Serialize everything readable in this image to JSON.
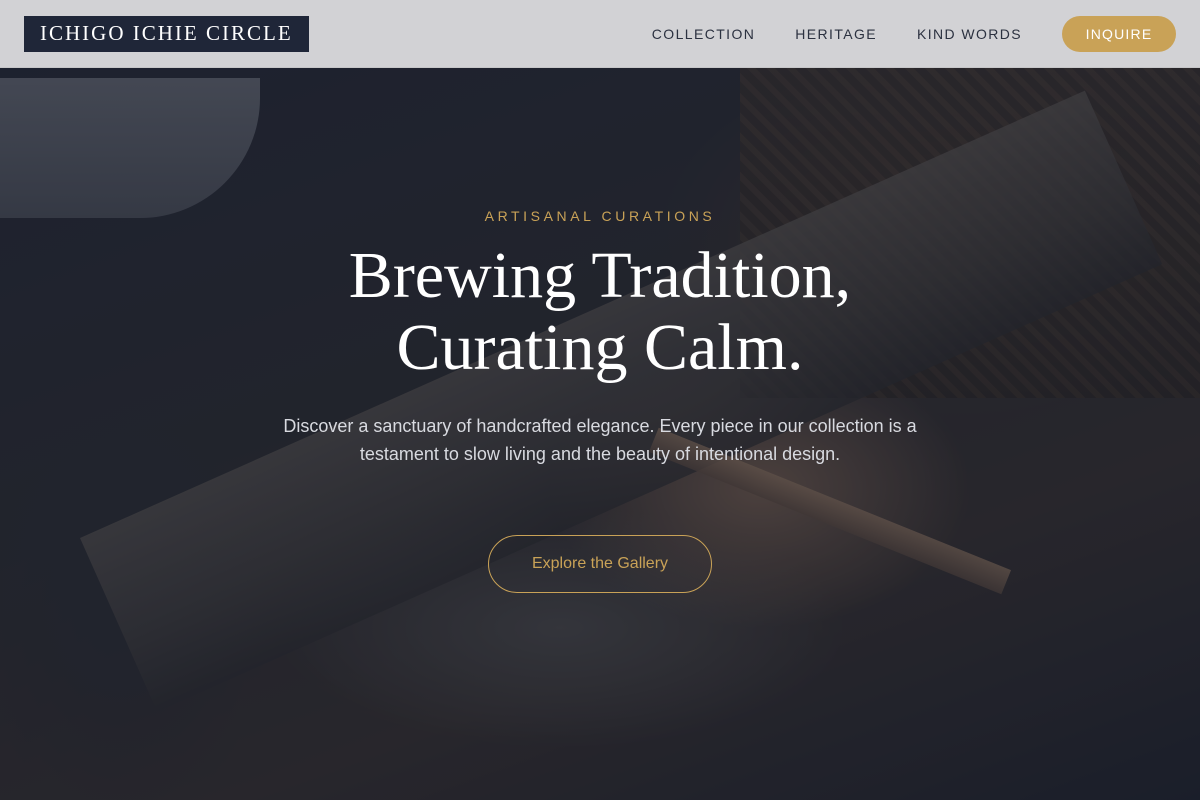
{
  "header": {
    "logo": "ICHIGO ICHIE CIRCLE",
    "nav": [
      {
        "label": "COLLECTION"
      },
      {
        "label": "HERITAGE"
      },
      {
        "label": "KIND WORDS"
      }
    ],
    "cta_label": "INQUIRE"
  },
  "hero": {
    "eyebrow": "ARTISANAL CURATIONS",
    "headline_line1": "Brewing Tradition,",
    "headline_line2": "Curating Calm.",
    "description": "Discover a sanctuary of handcrafted elegance. Every piece in our collection is a testament to slow living and the beauty of intentional design.",
    "button_label": "Explore the Gallery",
    "background": "woodworking-photo"
  },
  "colors": {
    "accent_gold": "#c9a257",
    "logo_bg": "#1f2638",
    "header_bg": "#dedee0",
    "nav_text": "#2b3140"
  }
}
